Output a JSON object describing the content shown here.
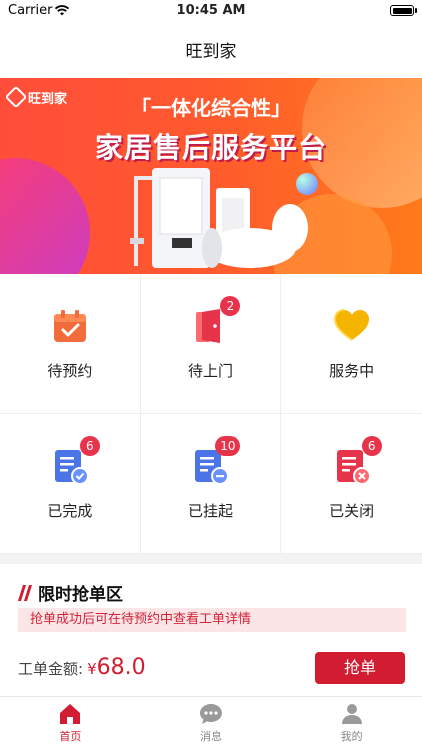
{
  "status_bar": {
    "carrier": "Carrier",
    "time": "10:45 AM"
  },
  "navbar": {
    "title": "旺到家"
  },
  "banner": {
    "logo_text": "旺到家",
    "line1": "「一体化综合性」",
    "line2": "家居售后服务平台"
  },
  "grid": {
    "items": [
      {
        "label": "待预约",
        "icon": "calendar-icon",
        "badge": null,
        "color": "#f26b3a"
      },
      {
        "label": "待上门",
        "icon": "door-icon",
        "badge": "2",
        "color": "#e8344b"
      },
      {
        "label": "服务中",
        "icon": "heart-icon",
        "badge": null,
        "color": "#f5b400"
      },
      {
        "label": "已完成",
        "icon": "doc-check-icon",
        "badge": "6",
        "color": "#4a74e8"
      },
      {
        "label": "已挂起",
        "icon": "doc-minus-icon",
        "badge": "10",
        "color": "#4a74e8"
      },
      {
        "label": "已关闭",
        "icon": "doc-close-icon",
        "badge": "6",
        "color": "#e8344b"
      }
    ]
  },
  "grab_section": {
    "title": "限时抢单区",
    "notice": "抢单成功后可在待预约中查看工单详情",
    "amount_label": "工单金额:",
    "currency": "¥",
    "amount_value": "68.0",
    "button_label": "抢单"
  },
  "tabbar": {
    "tabs": [
      {
        "label": "首页",
        "icon": "home-icon",
        "active": true
      },
      {
        "label": "消息",
        "icon": "chat-icon",
        "active": false
      },
      {
        "label": "我的",
        "icon": "user-icon",
        "active": false
      }
    ]
  },
  "colors": {
    "accent": "#d21c31",
    "badge": "#e8344b",
    "notice_bg": "#fbe5e7"
  }
}
